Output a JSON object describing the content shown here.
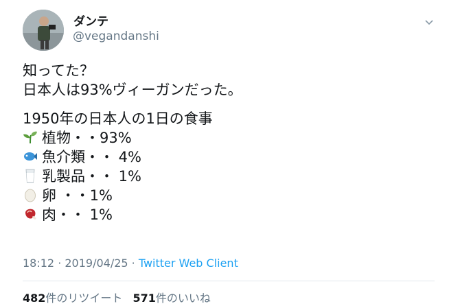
{
  "author": {
    "display_name": "ダンテ",
    "handle": "@vegandanshi"
  },
  "tweet": {
    "lines": [
      "知ってた？",
      "日本人は93%ヴィーガンだった。"
    ],
    "heading": "1950年の日本人の1日の食事",
    "items": [
      {
        "icon": "seedling-icon",
        "text": "植物・・93%"
      },
      {
        "icon": "fish-icon",
        "text": "魚介類・・ 4%"
      },
      {
        "icon": "milk-glass-icon",
        "text": "乳製品・・ 1%"
      },
      {
        "icon": "egg-icon",
        "text": "卵 ・・1%"
      },
      {
        "icon": "meat-icon",
        "text": "肉・・ 1%"
      }
    ]
  },
  "meta": {
    "time_date": "18:12 · 2019/04/25 · ",
    "client": "Twitter Web Client"
  },
  "stats": {
    "retweets_count": "482",
    "retweets_label": "件のリツイート",
    "likes_count": "571",
    "likes_label": "件のいいね"
  },
  "colors": {
    "text": "#14171a",
    "secondary": "#657786",
    "link": "#1da1f2",
    "divider": "#e1e8ed"
  }
}
